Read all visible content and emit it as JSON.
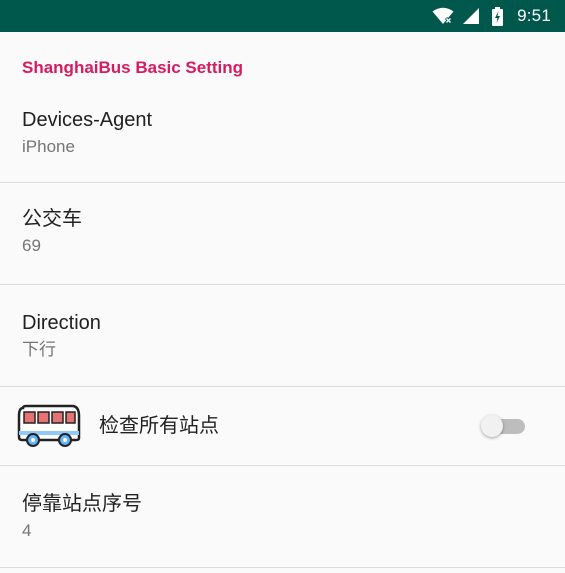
{
  "status_bar": {
    "time": "9:51",
    "background": "#00574b",
    "icons": [
      "wifi-icon",
      "cell-signal-icon",
      "battery-charging-icon"
    ]
  },
  "category": {
    "title": "ShanghaiBus Basic Setting",
    "color": "#d81b60"
  },
  "preferences": {
    "devices_agent": {
      "title": "Devices-Agent",
      "summary": "iPhone"
    },
    "bus": {
      "title": "公交车",
      "summary": "69"
    },
    "direction": {
      "title": "Direction",
      "summary": "下行"
    },
    "check_all_stops": {
      "title": "检查所有站点",
      "icon": "bus-icon",
      "enabled": false
    },
    "stop_index": {
      "title": "停靠站点序号",
      "summary": "4"
    }
  }
}
